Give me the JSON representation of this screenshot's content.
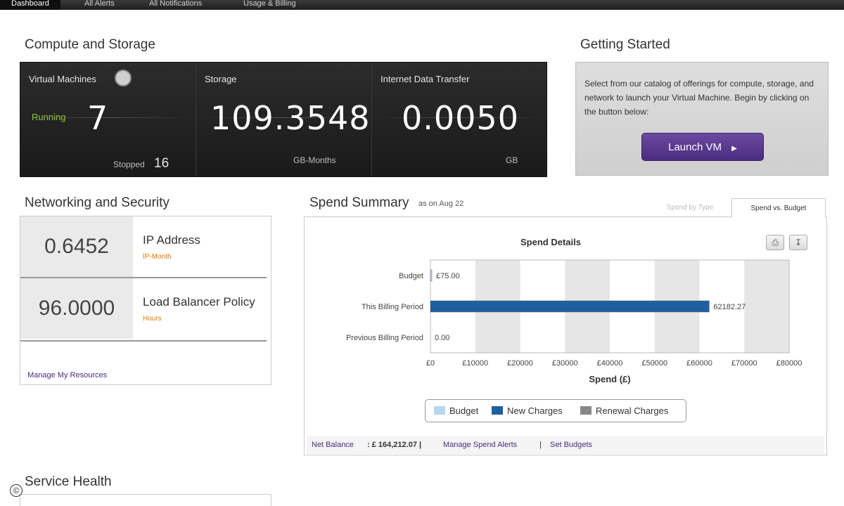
{
  "nav": {
    "tabs": [
      "Dashboard",
      "All Alerts",
      "All Notifications",
      "Usage & Billing"
    ]
  },
  "compute": {
    "title": "Compute and Storage",
    "vm_label": "Virtual Machines",
    "running_label": "Running",
    "running_value": "7",
    "stopped_label": "Stopped",
    "stopped_value": "16",
    "storage_label": "Storage",
    "storage_value": "109.3548",
    "storage_unit": "GB-Months",
    "transfer_label": "Internet Data Transfer",
    "transfer_value": "0.0050",
    "transfer_unit": "GB"
  },
  "getting_started": {
    "title": "Getting Started",
    "text": "Select from our catalog of offerings for compute, storage, and network to launch your Virtual Machine. Begin by clicking on the button below:",
    "button": "Launch VM"
  },
  "networking": {
    "title": "Networking and Security",
    "rows": [
      {
        "value": "0.6452",
        "name": "IP Address",
        "unit": "IP-Month"
      },
      {
        "value": "96.0000",
        "name": "Load Balancer Policy",
        "unit": "Hours"
      }
    ],
    "manage_link": "Manage My Resources"
  },
  "spend": {
    "title": "Spend Summary",
    "as_of": "as on  Aug 22",
    "tabs": [
      "Spend by Type",
      "Spend vs. Budget"
    ],
    "net_balance_label": "Net Balance",
    "net_balance_value": ": £ 164,212.07  |",
    "manage_alerts": "Manage Spend Alerts",
    "sep": "|",
    "set_budgets": "Set Budgets"
  },
  "chart_data": {
    "type": "bar",
    "orientation": "horizontal",
    "title": "Spend Details",
    "xlabel": "Spend (£)",
    "ylabel": "",
    "categories": [
      "Budget",
      "This Billing Period",
      "Previous Billing Period"
    ],
    "value_labels": [
      "£75.00",
      "62182.27",
      "0.00"
    ],
    "series": [
      {
        "name": "Budget",
        "color": "#b8d8f0",
        "values": [
          75,
          0,
          0
        ]
      },
      {
        "name": "New Charges",
        "color": "#1f5fa0",
        "values": [
          0,
          62182.27,
          0
        ]
      },
      {
        "name": "Renewal Charges",
        "color": "#888888",
        "values": [
          0,
          0,
          0
        ]
      }
    ],
    "xlim": [
      0,
      80000
    ],
    "xticks": [
      "£0",
      "£10000",
      "£20000",
      "£30000",
      "£40000",
      "£50000",
      "£60000",
      "£70000",
      "£80000"
    ],
    "grid": "alternating bands",
    "legend": "bottom"
  },
  "service_health": {
    "title": "Service Health"
  },
  "copyright_symbol": "©"
}
